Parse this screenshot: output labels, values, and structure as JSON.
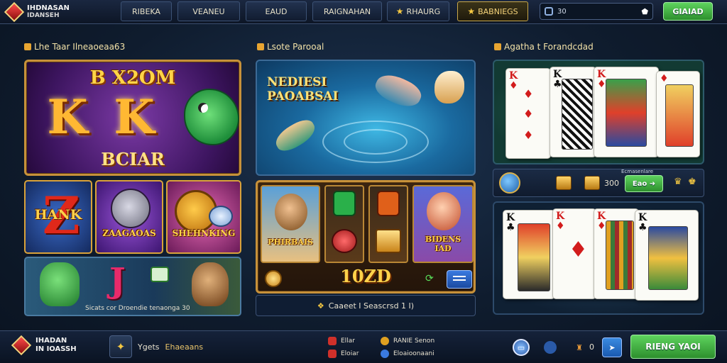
{
  "header": {
    "logo_line1": "IHDNASAN",
    "logo_line2": "IDANSEH",
    "tabs": [
      {
        "label": "RIBEKA"
      },
      {
        "label": "VEANEU"
      },
      {
        "label": "EAUD"
      },
      {
        "label": "RAIGNAHAN"
      },
      {
        "label": "RHAURG"
      },
      {
        "label": "BABNIEGS"
      }
    ],
    "search_value": "30",
    "cta_label": "GIAIAD"
  },
  "sections": {
    "slots_title": "Lhe Taar Ilneaoeaa63",
    "fishing_title": "Lsote Parooal",
    "cards_title": "Agatha t Forandcdad"
  },
  "slot_big": {
    "top_text": "B X2OM",
    "bottom_text": "BCIAR",
    "reel_symbols": [
      "K",
      "K"
    ]
  },
  "slot_tiles": [
    {
      "label": "HANK"
    },
    {
      "label": "ZAAGAOAS"
    },
    {
      "label": "SHEHNKING"
    }
  ],
  "slot_banner": {
    "glyph": "J",
    "caption": "Sicats cor Droendie tenaonga 30"
  },
  "fishing": {
    "title_line1": "NEDIESI",
    "title_line2": "PAOABSAI"
  },
  "slot_mid": {
    "left_label": "PHIRBAIS",
    "right_label_line1": "BIDENS",
    "right_label_line2": "IAD",
    "win_value": "10ZD",
    "status_text": "Caaeet I Seascrsd 1 I)"
  },
  "cards_controls": {
    "label": "Ecmasenlare",
    "amount": "300",
    "play_label": "Eao"
  },
  "cards_top": [
    {
      "rank": "K",
      "suit": "♦",
      "color": "red"
    },
    {
      "rank": "K",
      "suit": "♣",
      "color": "black"
    },
    {
      "rank": "K",
      "suit": "♦",
      "color": "red"
    },
    {
      "rank": "",
      "suit": "♦",
      "color": "red"
    }
  ],
  "cards_bot": [
    {
      "rank": "K",
      "suit": "♣",
      "color": "black"
    },
    {
      "rank": "K",
      "suit": "♦",
      "color": "red"
    },
    {
      "rank": "K",
      "suit": "♦",
      "color": "red"
    },
    {
      "rank": "K",
      "suit": "♣",
      "color": "black"
    }
  ],
  "footer": {
    "logo_line1": "IHADAN",
    "logo_line2": "IN IOASSH",
    "favorites_line1": "Ygets",
    "favorites_line2": "Ehaeaans",
    "links": [
      {
        "label": "Ellar"
      },
      {
        "label": "Eloiar"
      },
      {
        "label": "RANIE Senon"
      },
      {
        "label": "Eloaioonaani"
      }
    ],
    "counter": "0",
    "cta_label": "RIENG YAOI"
  },
  "colors": {
    "accent_gold": "#c7913a",
    "cta_green": "#3cae3c",
    "background": "#0f1c2e"
  }
}
